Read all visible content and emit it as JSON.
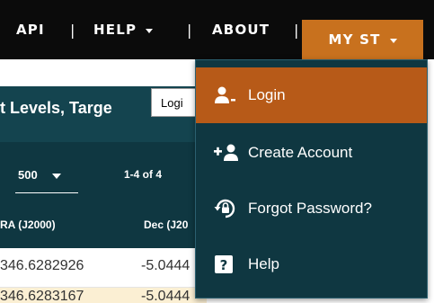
{
  "nav": {
    "api": "API",
    "sep": "|",
    "help": "HELP",
    "about": "ABOUT",
    "my_st": "MY ST"
  },
  "page": {
    "title": "t Levels, Targe",
    "tooltip": "Logi",
    "rows_per_page": "500",
    "pager": "1-4 of 4",
    "columns": [
      "RA (J2000)",
      "Dec (J20"
    ],
    "rows": [
      [
        "346.6282926",
        "-5.0444"
      ],
      [
        "346.6283167",
        "-5.0444"
      ]
    ]
  },
  "menu": {
    "items": [
      {
        "label": "Login",
        "icon": "login-user-icon"
      },
      {
        "label": "Create Account",
        "icon": "add-user-icon"
      },
      {
        "label": "Forgot Password?",
        "icon": "lock-reset-icon"
      },
      {
        "label": "Help",
        "icon": "help-icon"
      }
    ]
  },
  "colors": {
    "navbar": "#0b0b0b",
    "accent": "#c8711e",
    "menu_bg": "#0f3741",
    "menu_active": "#b75a18",
    "row_highlight": "#fbefd3"
  }
}
